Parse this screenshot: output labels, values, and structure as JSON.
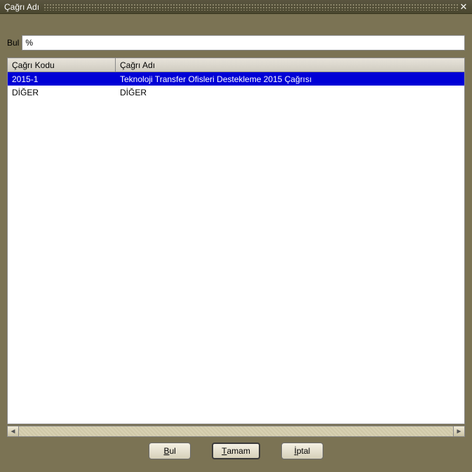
{
  "titlebar": {
    "title": "Çağrı Adı"
  },
  "search": {
    "label": "Bul",
    "value": "%"
  },
  "table": {
    "columns": {
      "kodu": "Çağrı Kodu",
      "adi": "Çağrı Adı"
    },
    "rows": [
      {
        "kodu": "2015-1",
        "adi": "Teknoloji Transfer Ofisleri Destekleme 2015 Çağrısı",
        "selected": true
      },
      {
        "kodu": "DİĞER",
        "adi": "DİĞER",
        "selected": false
      }
    ]
  },
  "buttons": {
    "bul_prefix": "B",
    "bul_rest": "ul",
    "tamam_prefix": "T",
    "tamam_rest": "amam",
    "iptal_prefix": "İ",
    "iptal_rest": "ptal"
  }
}
